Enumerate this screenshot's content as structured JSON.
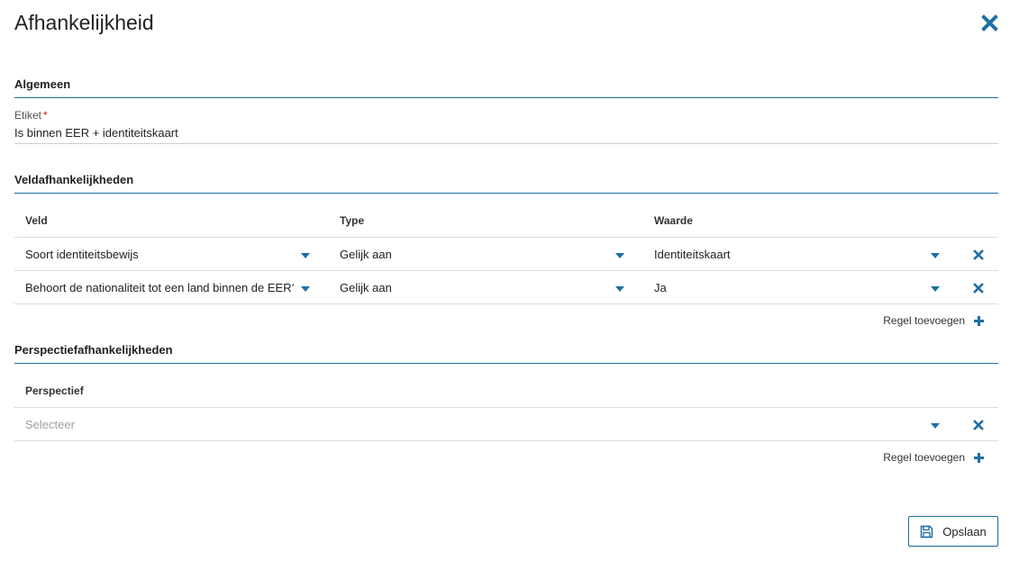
{
  "dialog": {
    "title": "Afhankelijkheid"
  },
  "general": {
    "section_title": "Algemeen",
    "label_field": {
      "label": "Etiket",
      "required_marker": "*",
      "value": "Is binnen EER + identiteitskaart"
    }
  },
  "field_dependencies": {
    "section_title": "Veldafhankelijkheden",
    "columns": [
      "Veld",
      "Type",
      "Waarde"
    ],
    "rows": [
      {
        "field": "Soort identiteitsbewijs",
        "type": "Gelijk aan",
        "value": "Identiteitskaart"
      },
      {
        "field": "Behoort de nationaliteit tot een land binnen de EER?",
        "type": "Gelijk aan",
        "value": "Ja"
      }
    ],
    "add_row_label": "Regel toevoegen"
  },
  "perspective_dependencies": {
    "section_title": "Perspectiefafhankelijkheden",
    "column": "Perspectief",
    "rows": [
      {
        "perspective_placeholder": "Selecteer"
      }
    ],
    "add_row_label": "Regel toevoegen"
  },
  "footer": {
    "save_label": "Opslaan"
  },
  "colors": {
    "accent": "#1d6fa5",
    "required": "#dd1111"
  },
  "icons": {
    "close": "close-icon",
    "dropdown": "caret-down-icon",
    "remove": "remove-row-icon",
    "add": "plus-icon",
    "save": "floppy-disk-icon"
  }
}
